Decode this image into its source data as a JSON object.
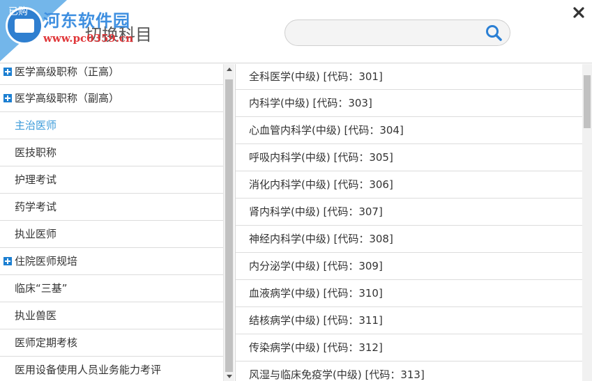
{
  "header": {
    "tab_label": "已购",
    "title": "切换科目",
    "watermark_site": "河东软件园",
    "watermark_url": "www.pc0359.cn",
    "search": {
      "value": "",
      "placeholder": ""
    }
  },
  "icons": {
    "search": "search-icon",
    "close": "close-icon",
    "expand": "expand-plus-icon"
  },
  "colors": {
    "accent": "#3a9ad9",
    "expand_icon": "#1c7fd1",
    "divider": "#dcdcdc"
  },
  "categories": [
    {
      "label": "医学高级职称（正高）",
      "expandable": true
    },
    {
      "label": "医学高级职称（副高）",
      "expandable": true
    },
    {
      "label": "主治医师",
      "expandable": false,
      "active": true
    },
    {
      "label": "医技职称",
      "expandable": false
    },
    {
      "label": "护理考试",
      "expandable": false
    },
    {
      "label": "药学考试",
      "expandable": false
    },
    {
      "label": "执业医师",
      "expandable": false
    },
    {
      "label": "住院医师规培",
      "expandable": true
    },
    {
      "label": "临床“三基”",
      "expandable": false
    },
    {
      "label": "执业兽医",
      "expandable": false
    },
    {
      "label": "医师定期考核",
      "expandable": false
    },
    {
      "label": "医用设备使用人员业务能力考评",
      "expandable": false
    }
  ],
  "subjects": [
    {
      "label": "全科医学(中级) [代码：301]"
    },
    {
      "label": "内科学(中级) [代码：303]"
    },
    {
      "label": "心血管内科学(中级) [代码：304]"
    },
    {
      "label": "呼吸内科学(中级) [代码：305]"
    },
    {
      "label": "消化内科学(中级) [代码：306]"
    },
    {
      "label": "肾内科学(中级) [代码：307]"
    },
    {
      "label": "神经内科学(中级) [代码：308]"
    },
    {
      "label": "内分泌学(中级) [代码：309]"
    },
    {
      "label": "血液病学(中级) [代码：310]"
    },
    {
      "label": "结核病学(中级) [代码：311]"
    },
    {
      "label": "传染病学(中级) [代码：312]"
    },
    {
      "label": "风湿与临床免疫学(中级) [代码：313]"
    }
  ]
}
